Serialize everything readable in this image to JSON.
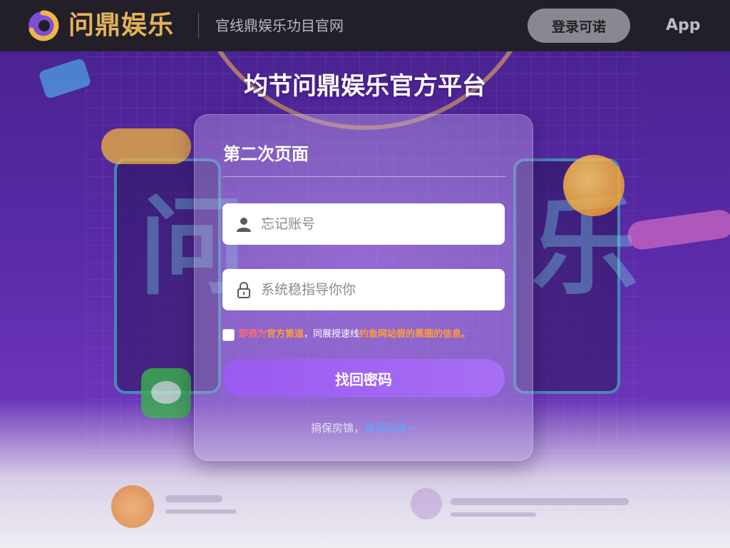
{
  "header": {
    "logo_text": "问鼎娱乐",
    "slogan": "官线鼎娱乐功目官网",
    "login_label": "登录可诺",
    "app_label": "App"
  },
  "page_title": "均节问鼎娱乐官方平台",
  "card": {
    "title": "第二次页面",
    "username_placeholder": "忘记账号",
    "password_placeholder": "系统稳指导你你",
    "agreement": {
      "part1": "即恐为",
      "part2": "官方第道",
      "part3": "，同展授速线",
      "part4": "约鱼网站假的黑圈的信息。"
    },
    "submit_label": "找回密码",
    "footer_text": "捐保房锦，",
    "footer_link": "黄诺刮换一"
  },
  "background": {
    "neon_left": "问",
    "neon_right": "乐"
  },
  "colors": {
    "header_bg": "#221f28",
    "logo_gold": "#e3b25a",
    "button_purple": "#9a5bf0",
    "link_blue": "#5fa6ff",
    "warning_orange": "#ff9c3a"
  }
}
